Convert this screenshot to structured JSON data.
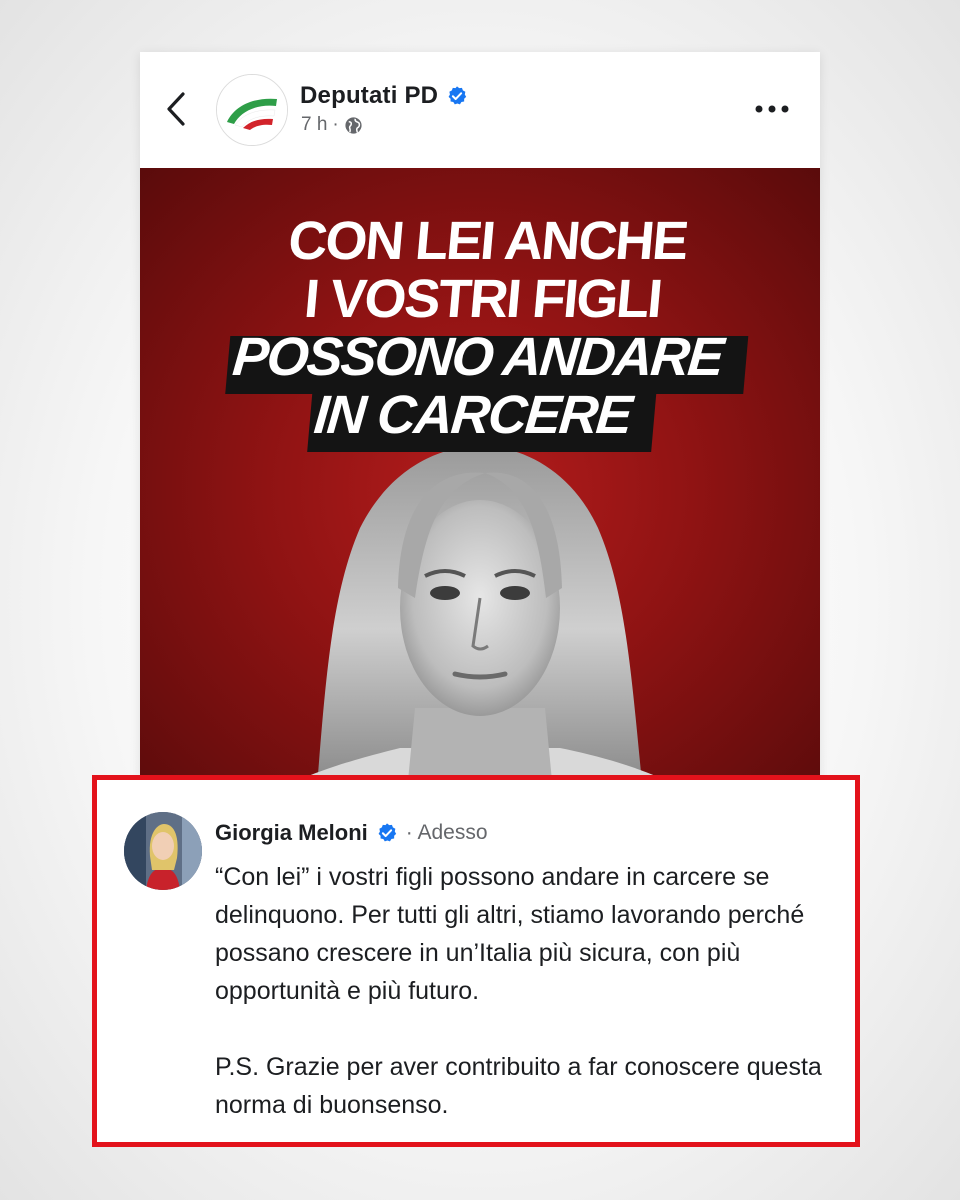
{
  "post": {
    "page_name": "Deputati PD",
    "time": "7 h",
    "separator": "·",
    "icons": {
      "back": "chevron-left-icon",
      "verified": "verified-badge-icon",
      "audience": "globe-icon",
      "more": "more-horizontal-icon"
    },
    "image": {
      "headline_lines": [
        "CON LEI ANCHE",
        "I VOSTRI FIGLI",
        "POSSONO ANDARE",
        "IN CARCERE"
      ],
      "background_color": "#a51717"
    }
  },
  "comment": {
    "author": "Giorgia Meloni",
    "time": "· Adesso",
    "paragraph_1": "“Con lei” i vostri figli possono andare in carcere se delinquono. Per tutti gli altri, stiamo lavorando perché possano crescere in un’Italia più sicura, con più opportunità e più futuro.",
    "paragraph_2": "P.S. Grazie per aver contribuito a far conoscere questa norma di buonsenso.",
    "highlight_color": "#e3121b"
  },
  "colors": {
    "verified": "#1877f2",
    "text_primary": "#1c1e21",
    "text_secondary": "#65676b"
  }
}
